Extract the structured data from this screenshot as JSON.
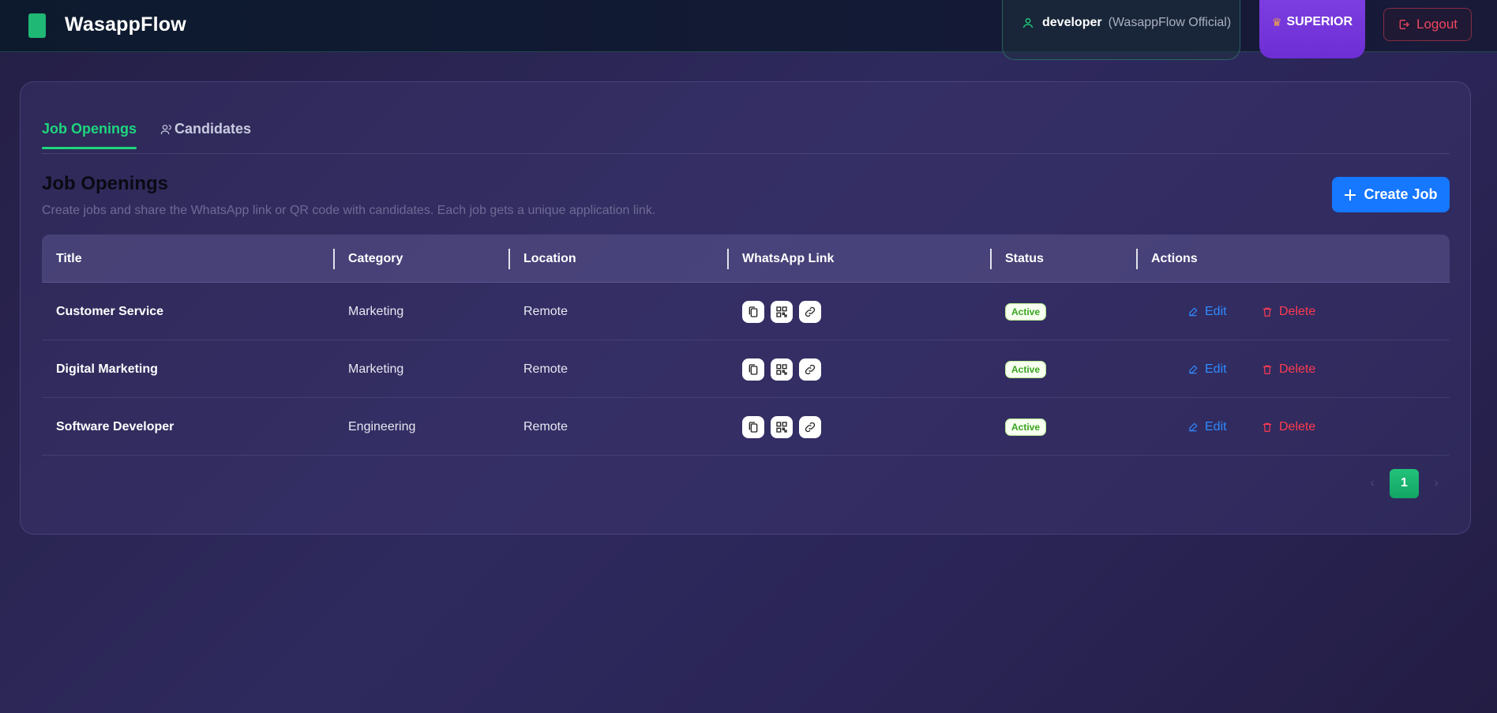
{
  "app": {
    "title": "WasappFlow"
  },
  "user": {
    "name": "developer",
    "org": "(WasappFlow Official)"
  },
  "plan": {
    "label": "SUPERIOR"
  },
  "logout": {
    "label": "Logout"
  },
  "tabs": [
    {
      "label": "Job Openings",
      "active": true
    },
    {
      "label": "Candidates",
      "active": false
    }
  ],
  "section": {
    "title": "Job Openings",
    "description": "Create jobs and share the WhatsApp link or QR code with candidates. Each job gets a unique application link.",
    "create_label": "Create Job"
  },
  "table": {
    "headers": [
      "Title",
      "Category",
      "Location",
      "WhatsApp Link",
      "Status",
      "Actions"
    ],
    "rows": [
      {
        "title": "Customer Service",
        "category": "Marketing",
        "location": "Remote",
        "status": "Active",
        "edit": "Edit",
        "delete": "Delete"
      },
      {
        "title": "Digital Marketing",
        "category": "Marketing",
        "location": "Remote",
        "status": "Active",
        "edit": "Edit",
        "delete": "Delete"
      },
      {
        "title": "Software Developer",
        "category": "Engineering",
        "location": "Remote",
        "status": "Active",
        "edit": "Edit",
        "delete": "Delete"
      }
    ],
    "link_icons": [
      "copy-icon",
      "qr-code-icon",
      "link-icon"
    ]
  },
  "pagination": {
    "current": "1"
  },
  "colors": {
    "accent_green": "#1ed67d",
    "primary_blue": "#1677ff",
    "danger_red": "#ff3b4f",
    "plan_purple": "#7c3ee0"
  }
}
